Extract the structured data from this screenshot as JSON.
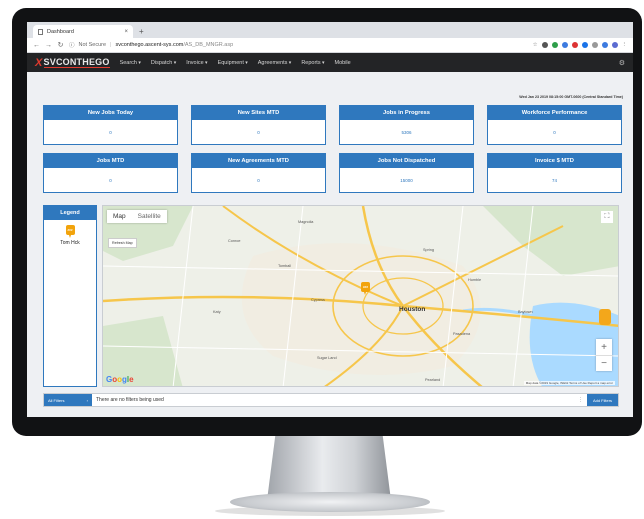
{
  "browser": {
    "tab_title": "Dashboard",
    "tab_close": "×",
    "new_tab": "+",
    "security": "Not Secure",
    "url_host": "svconthego.ascent-sys.com",
    "url_path": "/AS_DB_MNGR.asp"
  },
  "app": {
    "logo_x": "X",
    "logo_brand": "SVCONTHEGO",
    "menu": [
      "Search",
      "Dispatch",
      "Invoice",
      "Equipment",
      "Agreements",
      "Reports",
      "Mobile"
    ],
    "gear": "⚙"
  },
  "dashboard": {
    "datestamp": "Wed Jan 23 2019 08:15:00 GMT-0600 (Central Standard Time)",
    "cards": [
      {
        "title": "New Jobs Today",
        "value": "0"
      },
      {
        "title": "New Sites MTD",
        "value": "0"
      },
      {
        "title": "Jobs in Progress",
        "value": "5306"
      },
      {
        "title": "Workforce Performance",
        "value": "0"
      },
      {
        "title": "Jobs MTD",
        "value": "0"
      },
      {
        "title": "New Agreements MTD",
        "value": "0"
      },
      {
        "title": "Jobs Not Dispatched",
        "value": "15000"
      },
      {
        "title": "Invoice $ MTD",
        "value": "74"
      }
    ]
  },
  "legend": {
    "title": "Legend",
    "items": [
      {
        "label": "Tom Hck",
        "pin_text": "###"
      }
    ]
  },
  "map": {
    "tab_map": "Map",
    "tab_satellite": "Satellite",
    "refresh": "Refresh Map",
    "google": [
      "G",
      "o",
      "o",
      "g",
      "l",
      "e"
    ],
    "attribution": "Map data ©2019 Google, INEGI   Terms of Use   Report a map error",
    "zoom_in": "+",
    "zoom_out": "−",
    "fullscreen": "⛶",
    "cities": [
      "Houston",
      "Sugar Land",
      "Pasadena",
      "Pearland",
      "Baytown",
      "Katy",
      "Cypress",
      "Spring",
      "Humble",
      "Tomball",
      "Magnolia",
      "Conroe"
    ],
    "pin_text": "###"
  },
  "filterbar": {
    "all_filters": "All Filters",
    "chevron": "›",
    "message": "There are no filters being used",
    "ellipsis": "⋮",
    "add": "Add Filters"
  }
}
